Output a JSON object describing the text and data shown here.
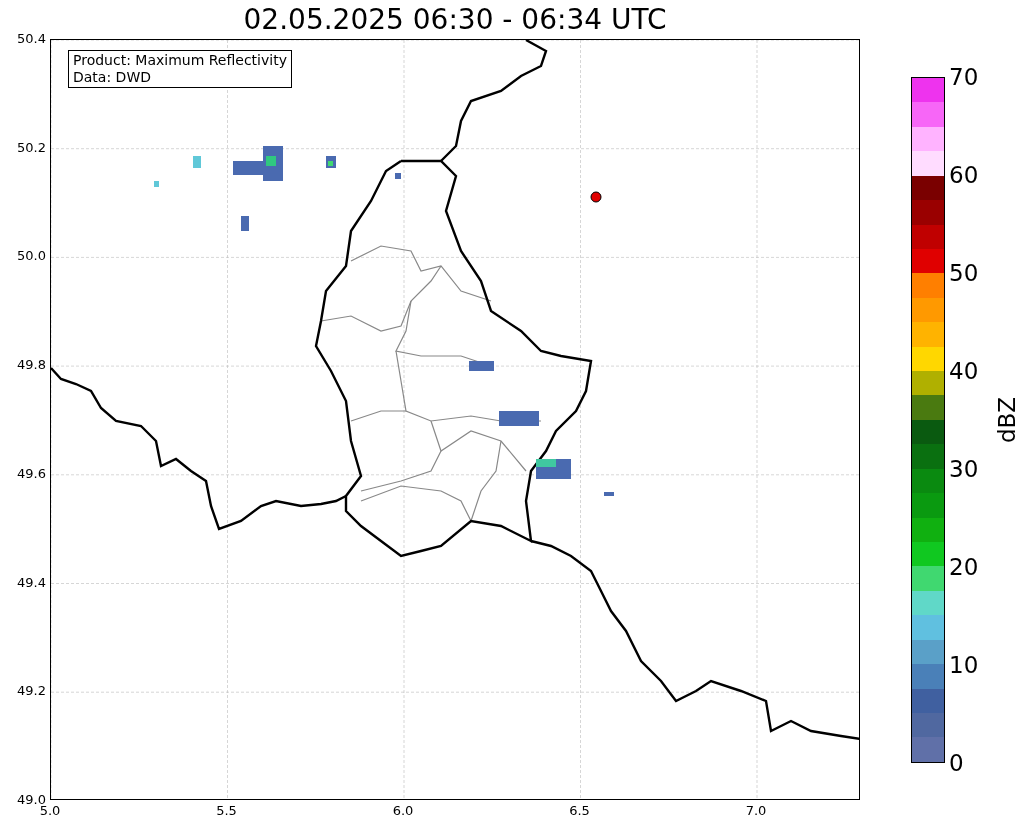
{
  "title": "02.05.2025 06:30 - 06:34 UTC",
  "info_box": [
    "Product: Maximum Reflectivity",
    "Data: DWD"
  ],
  "x_ticks": [
    "5.0",
    "5.5",
    "6.0",
    "6.5",
    "7.0"
  ],
  "y_ticks": [
    "50.4",
    "50.2",
    "50.0",
    "49.8",
    "49.6",
    "49.4",
    "49.2",
    "49.0"
  ],
  "colorbar": {
    "label": "dBZ",
    "ticks": [
      "70",
      "60",
      "50",
      "40",
      "30",
      "20",
      "10",
      "0"
    ],
    "segments": [
      {
        "color": "#ee33ee"
      },
      {
        "color": "#f766f7"
      },
      {
        "color": "#ffb3ff"
      },
      {
        "color": "#ffdcff"
      },
      {
        "color": "#7a0000"
      },
      {
        "color": "#9a0000"
      },
      {
        "color": "#c00000"
      },
      {
        "color": "#e00000"
      },
      {
        "color": "#ff7f00"
      },
      {
        "color": "#ff9900"
      },
      {
        "color": "#ffb300"
      },
      {
        "color": "#ffd700"
      },
      {
        "color": "#b0b000"
      },
      {
        "color": "#4a7a10"
      },
      {
        "color": "#0a5a10"
      },
      {
        "color": "#0a7010"
      },
      {
        "color": "#0a8a10"
      },
      {
        "color": "#0a9a10"
      },
      {
        "color": "#10b010"
      },
      {
        "color": "#10c820"
      },
      {
        "color": "#40d870"
      },
      {
        "color": "#60d8c8"
      },
      {
        "color": "#60c0e0"
      },
      {
        "color": "#5aa0c8"
      },
      {
        "color": "#4a80b8"
      },
      {
        "color": "#4060a0"
      },
      {
        "color": "#5068a0"
      },
      {
        "color": "#6070a8"
      }
    ]
  }
}
